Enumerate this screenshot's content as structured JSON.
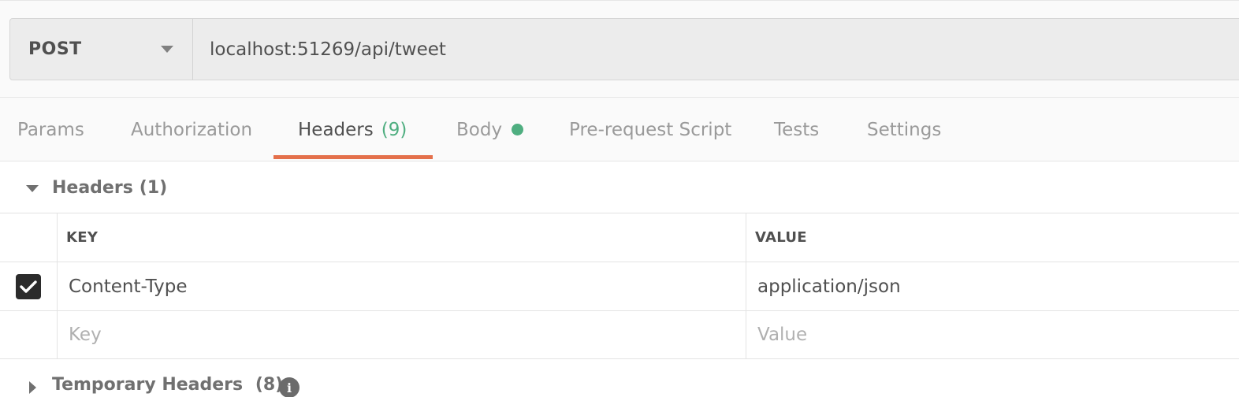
{
  "request": {
    "method": "POST",
    "url": "localhost:51269/api/tweet"
  },
  "tabs": [
    {
      "label": "Params"
    },
    {
      "label": "Authorization"
    },
    {
      "label": "Headers",
      "count": "(9)",
      "active": true
    },
    {
      "label": "Body",
      "indicator": "green-dot"
    },
    {
      "label": "Pre-request Script"
    },
    {
      "label": "Tests"
    },
    {
      "label": "Settings"
    }
  ],
  "headers_section": {
    "title": "Headers",
    "count": "(1)",
    "expanded": true
  },
  "table": {
    "columns": {
      "key": "KEY",
      "value": "VALUE"
    },
    "rows": [
      {
        "checked": true,
        "key": "Content-Type",
        "value": "application/json"
      }
    ],
    "placeholders": {
      "key": "Key",
      "value": "Value"
    }
  },
  "temporary_headers": {
    "title": "Temporary Headers",
    "count": "(8)",
    "expanded": false,
    "info_icon": "i"
  },
  "colors": {
    "accent_underline": "#e4704b",
    "count_green": "#4fae80"
  }
}
